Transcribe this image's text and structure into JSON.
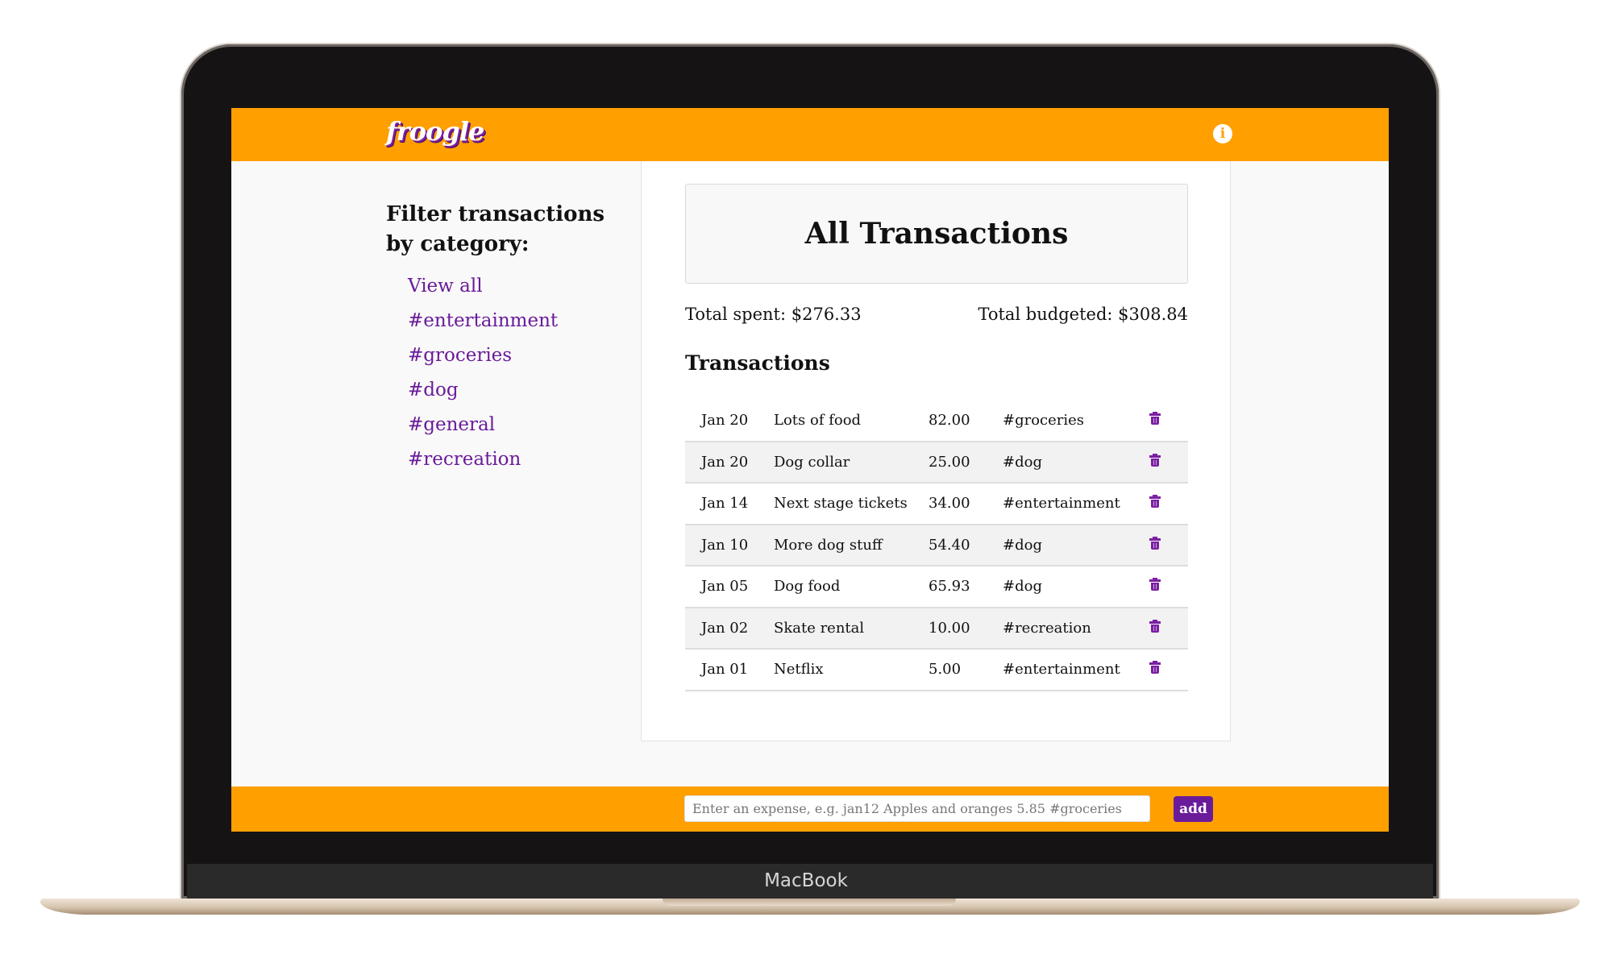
{
  "device": {
    "label": "MacBook"
  },
  "header": {
    "logo_text": "froogle",
    "info_icon": "info-circle-icon",
    "info_glyph": "i"
  },
  "sidebar": {
    "heading": "Filter transactions by category:",
    "items": [
      {
        "label": "View all"
      },
      {
        "label": "#entertainment"
      },
      {
        "label": "#groceries"
      },
      {
        "label": "#dog"
      },
      {
        "label": "#general"
      },
      {
        "label": "#recreation"
      }
    ]
  },
  "main": {
    "title": "All Transactions",
    "total_spent": "Total spent: $276.33",
    "total_budgeted": "Total budgeted: $308.84",
    "section_heading": "Transactions",
    "delete_icon": "trash-icon",
    "transactions": [
      {
        "date": "Jan 20",
        "description": "Lots of food",
        "amount": "82.00",
        "category": "#groceries"
      },
      {
        "date": "Jan 20",
        "description": "Dog collar",
        "amount": "25.00",
        "category": "#dog"
      },
      {
        "date": "Jan 14",
        "description": "Next stage tickets",
        "amount": "34.00",
        "category": "#entertainment"
      },
      {
        "date": "Jan 10",
        "description": "More dog stuff",
        "amount": "54.40",
        "category": "#dog"
      },
      {
        "date": "Jan 05",
        "description": "Dog food",
        "amount": "65.93",
        "category": "#dog"
      },
      {
        "date": "Jan 02",
        "description": "Skate rental",
        "amount": "10.00",
        "category": "#recreation"
      },
      {
        "date": "Jan 01",
        "description": "Netflix",
        "amount": "5.00",
        "category": "#entertainment"
      }
    ]
  },
  "footer": {
    "input_placeholder": "Enter an expense, e.g. jan12 Apples and oranges 5.85 #groceries",
    "input_value": "",
    "add_label": "add"
  },
  "colors": {
    "accent_orange": "#ff9f00",
    "accent_purple": "#6a1b9a",
    "laptop_bezel": "#151313",
    "laptop_gold": "#d5c3ad"
  }
}
